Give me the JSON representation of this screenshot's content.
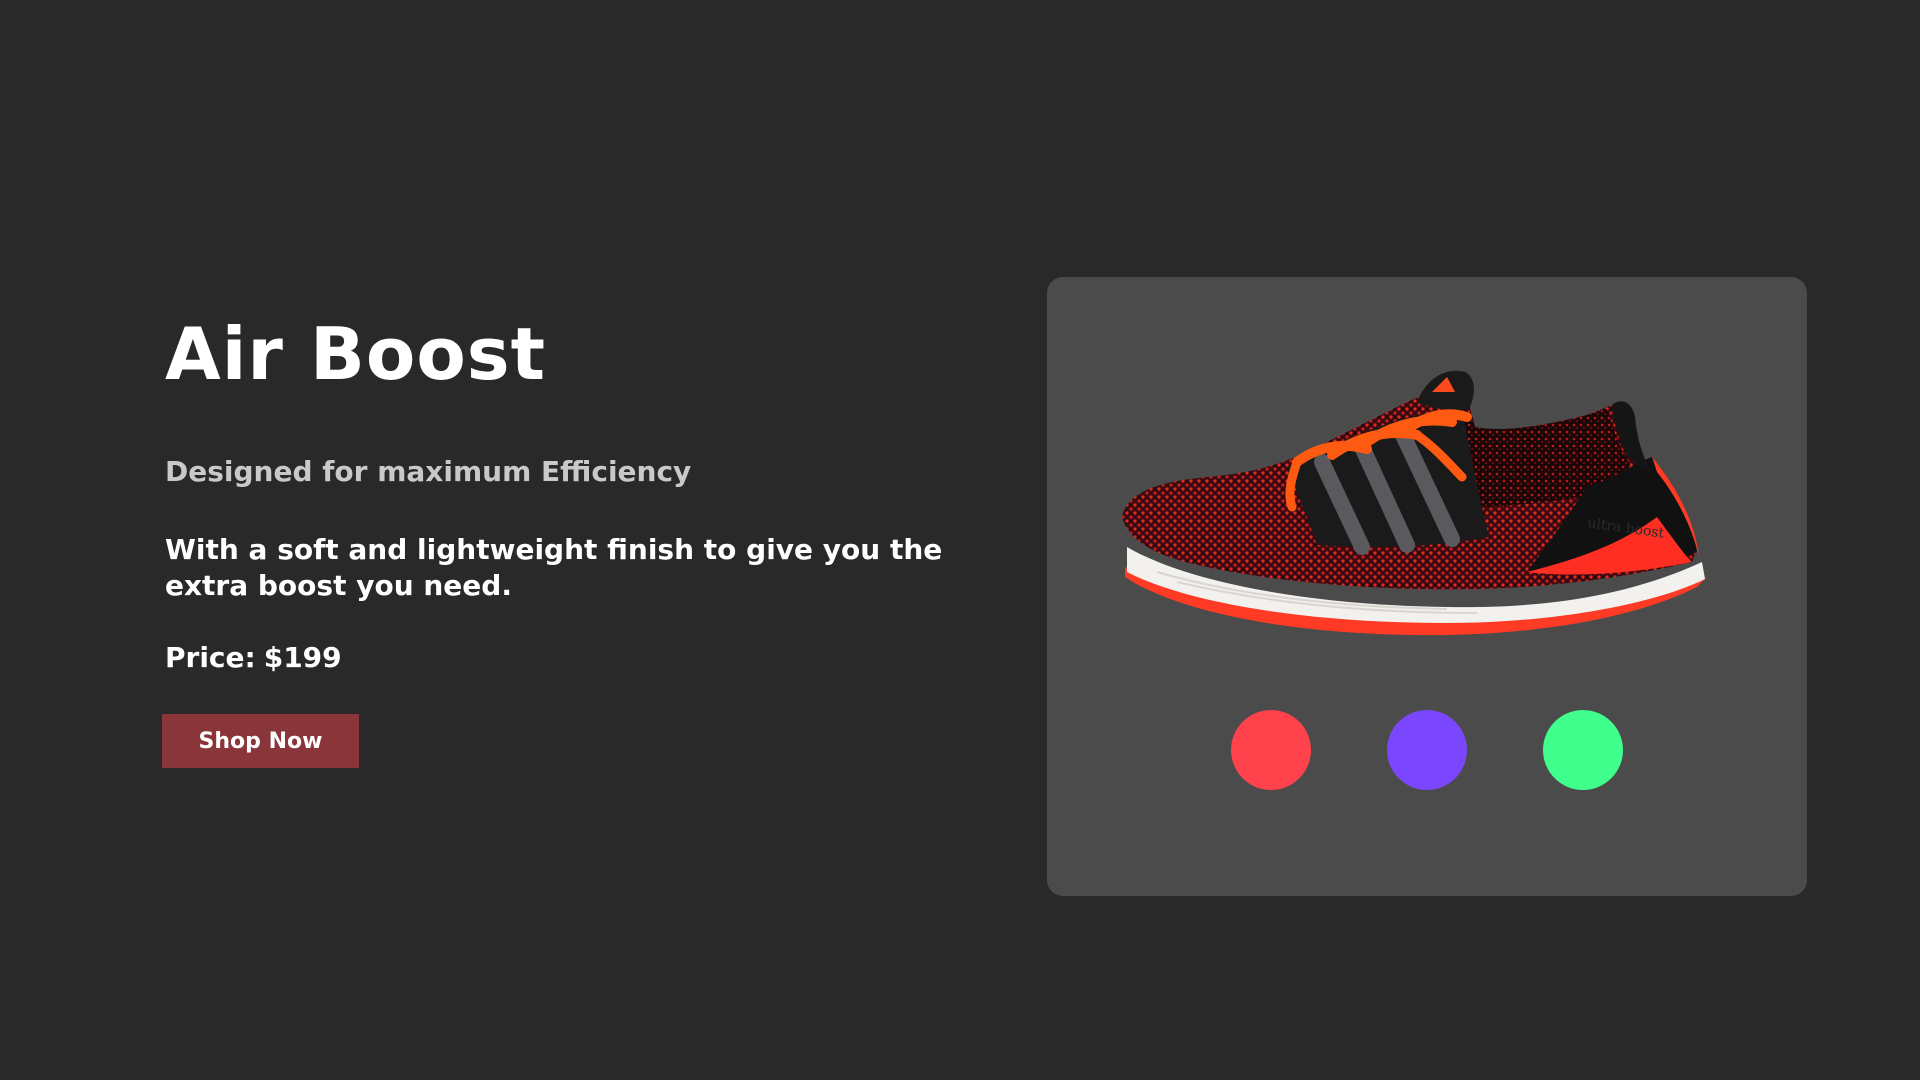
{
  "product": {
    "title": "Air Boost",
    "subtitle": "Designed for maximum Efficiency",
    "description": "With a soft and lightweight finish to give you the extra boost you need.",
    "price_label": "Price:",
    "price_value": "$199",
    "cta_label": "Shop Now",
    "image_text": "ultra boost"
  },
  "colors": {
    "background": "#292929",
    "card": "#4b4b4b",
    "cta": "#8a3539",
    "shoe_accent": "#ff4422",
    "shoe_body": "#1a1a1a"
  },
  "swatches": [
    {
      "name": "red",
      "color": "#ff424b"
    },
    {
      "name": "purple",
      "color": "#7a47ff"
    },
    {
      "name": "green",
      "color": "#40ff8c"
    }
  ]
}
